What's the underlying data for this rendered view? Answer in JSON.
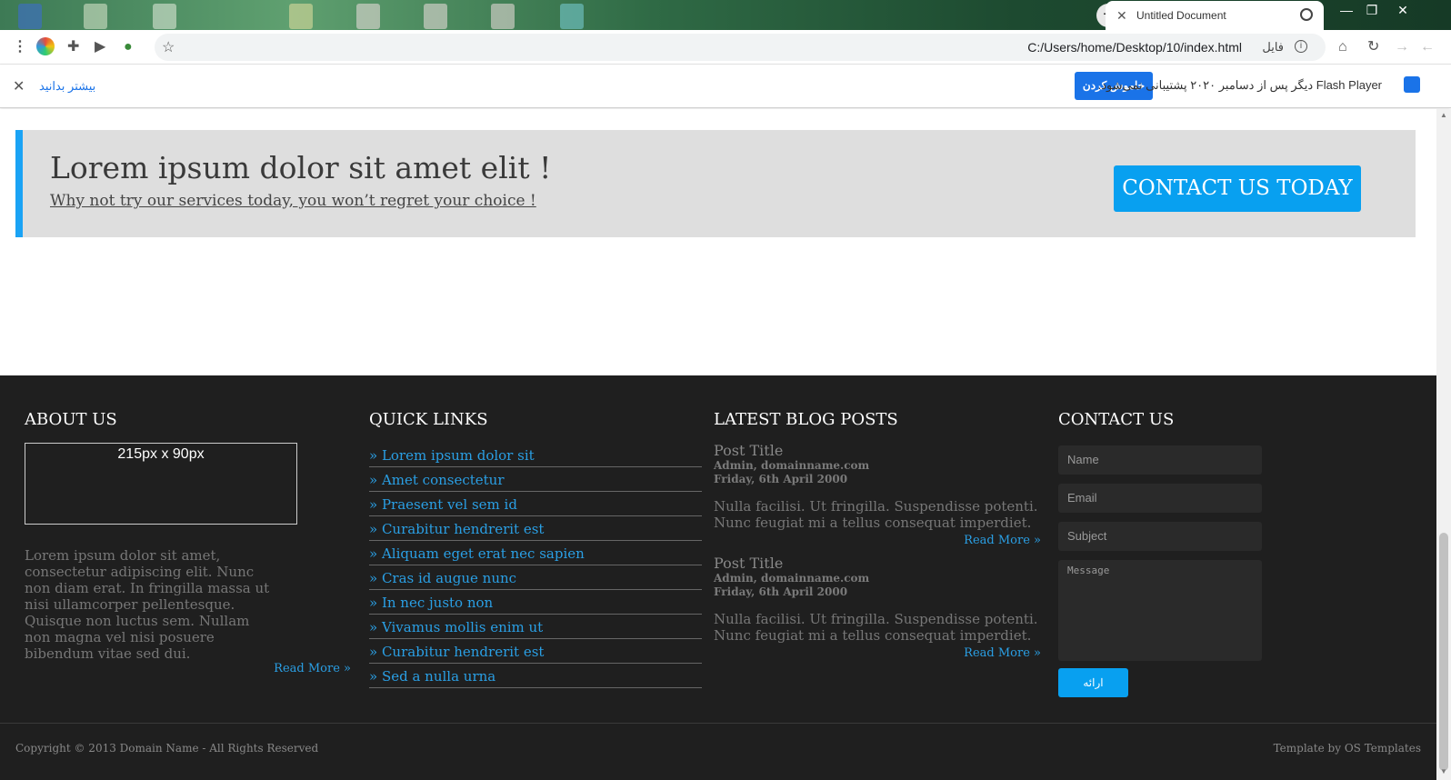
{
  "browser": {
    "tab_title": "Untitled Document",
    "url": "C:/Users/home/Desktop/10/index.html",
    "url_scheme_label": "فایل",
    "infobar": {
      "message": "Flash Player دیگر پس از دسامبر ۲۰۲۰ پشتیبانی نمی‌شود.",
      "turn_off_label": "خاموش کردن",
      "learn_more_label": "بیشتر بدانید"
    }
  },
  "cta": {
    "title": "Lorem ipsum dolor sit amet elit !",
    "subtitle": "Why not try our services today, you won’t regret your choice !",
    "button_label": "CONTACT US TODAY"
  },
  "footer": {
    "about": {
      "heading": "ABOUT US",
      "image_placeholder": "215px x 90px",
      "text": "Lorem ipsum dolor sit amet, consectetur adipiscing elit. Nunc non diam erat. In fringilla massa ut nisi ullamcorper pellentesque. Quisque non luctus sem. Nullam non magna vel nisi posuere bibendum vitae sed dui.",
      "read_more": "Read More »"
    },
    "quick_links": {
      "heading": "QUICK LINKS",
      "items": [
        "» Lorem ipsum dolor sit",
        "» Amet consectetur",
        "» Praesent vel sem id",
        "» Curabitur hendrerit est",
        "» Aliquam eget erat nec sapien",
        "» Cras id augue nunc",
        "» In nec justo non",
        "» Vivamus mollis enim ut",
        "» Curabitur hendrerit est",
        "» Sed a nulla urna"
      ]
    },
    "blog": {
      "heading": "LATEST BLOG POSTS",
      "posts": [
        {
          "title": "Post Title",
          "author": "Admin, domainname.com",
          "date": "Friday, 6th April 2000",
          "body": "Nulla facilisi. Ut fringilla. Suspendisse potenti. Nunc feugiat mi a tellus consequat imperdiet.",
          "read_more": "Read More »"
        },
        {
          "title": "Post Title",
          "author": "Admin, domainname.com",
          "date": "Friday, 6th April 2000",
          "body": "Nulla facilisi. Ut fringilla. Suspendisse potenti. Nunc feugiat mi a tellus consequat imperdiet.",
          "read_more": "Read More »"
        }
      ]
    },
    "contact": {
      "heading": "CONTACT US",
      "name_placeholder": "Name",
      "email_placeholder": "Email",
      "subject_placeholder": "Subject",
      "message_placeholder": "Message",
      "submit_label": "ارائه"
    }
  },
  "bottom": {
    "copyright": "Copyright © 2013 Domain Name - All Rights Reserved",
    "template_credit": "Template by OS Templates"
  },
  "colors": {
    "accent": "#08a0f0",
    "footer_bg": "#1f1f1f",
    "cta_bg": "#dedede",
    "link": "#2a9fe4"
  }
}
